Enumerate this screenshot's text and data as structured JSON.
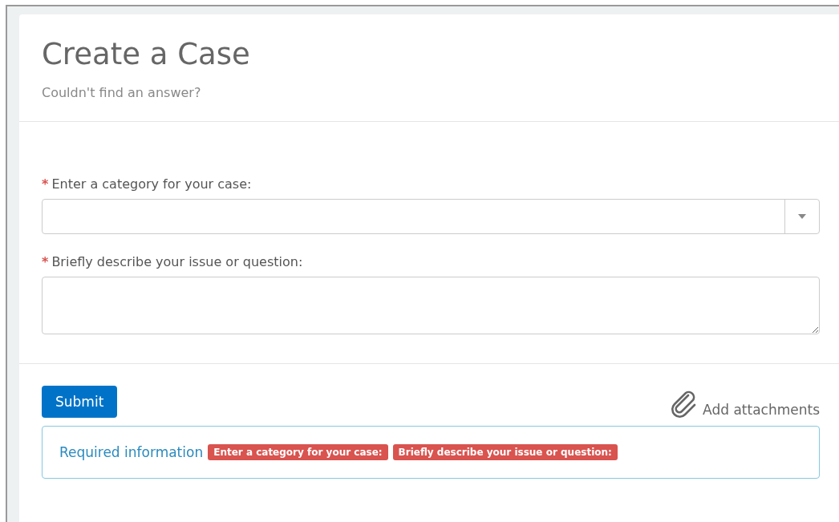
{
  "header": {
    "title": "Create a Case",
    "subtitle": "Couldn't find an answer?"
  },
  "fields": [
    {
      "kind": "select",
      "required_mark": "*",
      "label": "Enter a category for your case:"
    },
    {
      "kind": "textarea",
      "required_mark": "*",
      "label": "Briefly describe your issue or question:"
    }
  ],
  "submit_button": "Submit",
  "attachments_link": "Add attachments",
  "required_info": {
    "label": "Required information",
    "missing": [
      "Enter a category for your case:",
      "Briefly describe your issue or question:"
    ]
  }
}
